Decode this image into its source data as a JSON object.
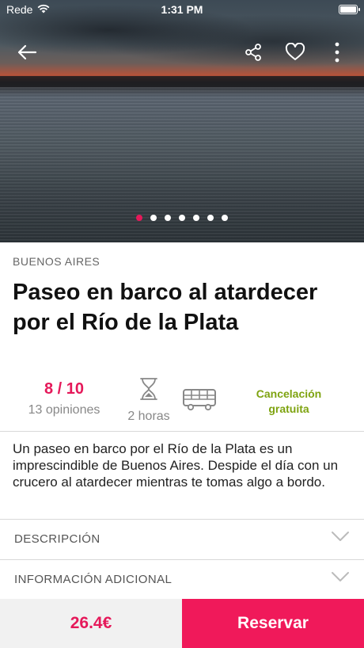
{
  "status_bar": {
    "carrier": "Rede",
    "time": "1:31 PM"
  },
  "hero": {
    "slide_count": 7,
    "active_slide": 0
  },
  "tour": {
    "city": "BUENOS AIRES",
    "title": "Paseo en barco al atardecer por el Río de la Plata",
    "rating": "8 / 10",
    "reviews": "13 opiniones",
    "duration": "2 horas",
    "cancellation": "Cancelación gratuita",
    "description": "Un paseo en barco por el Río de la Plata es un imprescindible de Buenos Aires. Despide el día con un crucero al atardecer mientras te tomas algo a bordo."
  },
  "sections": [
    {
      "label": "DESCRIPCIÓN"
    },
    {
      "label": "INFORMACIÓN ADICIONAL"
    }
  ],
  "booking": {
    "price": "26.4€",
    "reserve_label": "Reservar"
  },
  "colors": {
    "accent": "#e5195a",
    "cancel_green": "#7ea310",
    "reserve_bg": "#f0195a"
  },
  "icons": [
    "wifi-icon",
    "battery-icon",
    "back-arrow-icon",
    "share-icon",
    "heart-icon",
    "more-vertical-icon",
    "hourglass-icon",
    "bus-icon",
    "chevron-down-icon"
  ]
}
